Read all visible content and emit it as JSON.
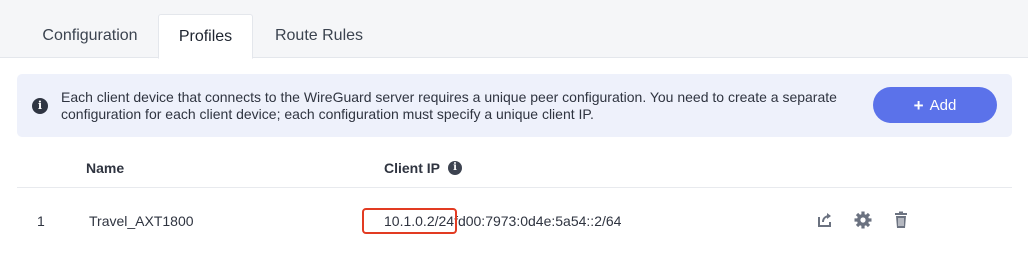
{
  "tabs": [
    {
      "label": "Configuration",
      "active": false
    },
    {
      "label": "Profiles",
      "active": true
    },
    {
      "label": "Route Rules",
      "active": false
    }
  ],
  "info_banner": {
    "icon": "info-icon",
    "text": "Each client device that connects to the WireGuard server requires a unique peer configuration. You need to create a separate configuration for each client device; each configuration must specify a unique client IP.",
    "add_label": "Add",
    "add_icon": "plus-icon"
  },
  "table": {
    "headers": {
      "name": "Name",
      "client_ip": "Client IP"
    },
    "rows": [
      {
        "index": "1",
        "name": "Travel_AXT1800",
        "ipv4": "10.1.0.2/24",
        "ipv6": "fd00:7973:0d4e:5a54::2/64"
      }
    ],
    "row_actions": [
      "share-icon",
      "settings-icon",
      "delete-icon"
    ]
  },
  "colors": {
    "accent": "#5b72ea",
    "banner_bg": "#eef1fb",
    "highlight": "#e23b22"
  }
}
